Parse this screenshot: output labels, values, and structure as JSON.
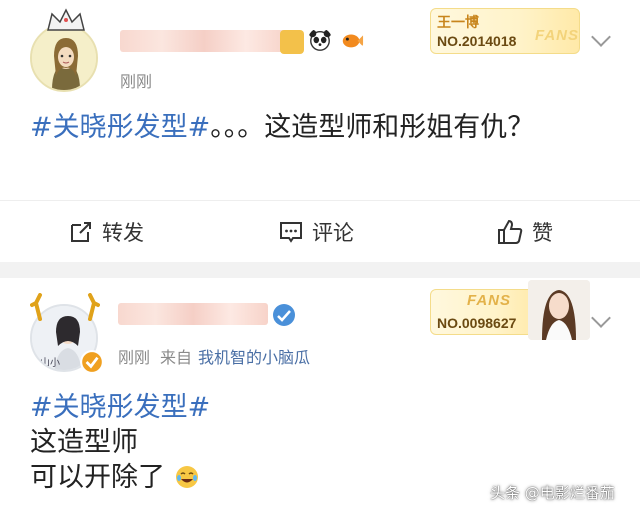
{
  "posts": [
    {
      "time": "刚刚",
      "fans_badge": {
        "name": "王一博",
        "number": "NO.2014018",
        "fans_label": "FANS"
      },
      "hashtag": "#关晓彤发型#",
      "text": "。。。这造型师和彤姐有仇？",
      "actions": {
        "repost": "转发",
        "comment": "评论",
        "like": "赞"
      }
    },
    {
      "time": "刚刚",
      "source_prefix": "来自",
      "source_name": "我机智的小脑瓜",
      "fans_badge": {
        "name": "",
        "number": "NO.0098627",
        "fans_label": "FANS"
      },
      "hashtag": "#关晓彤发型#",
      "lines": [
        "这造型师",
        "可以开除了"
      ]
    }
  ],
  "watermark": "头条 @电影烂番茄",
  "colors": {
    "link": "#3a6fbd",
    "meta": "#8a8a8a",
    "badge_gold": "#c8851c"
  }
}
